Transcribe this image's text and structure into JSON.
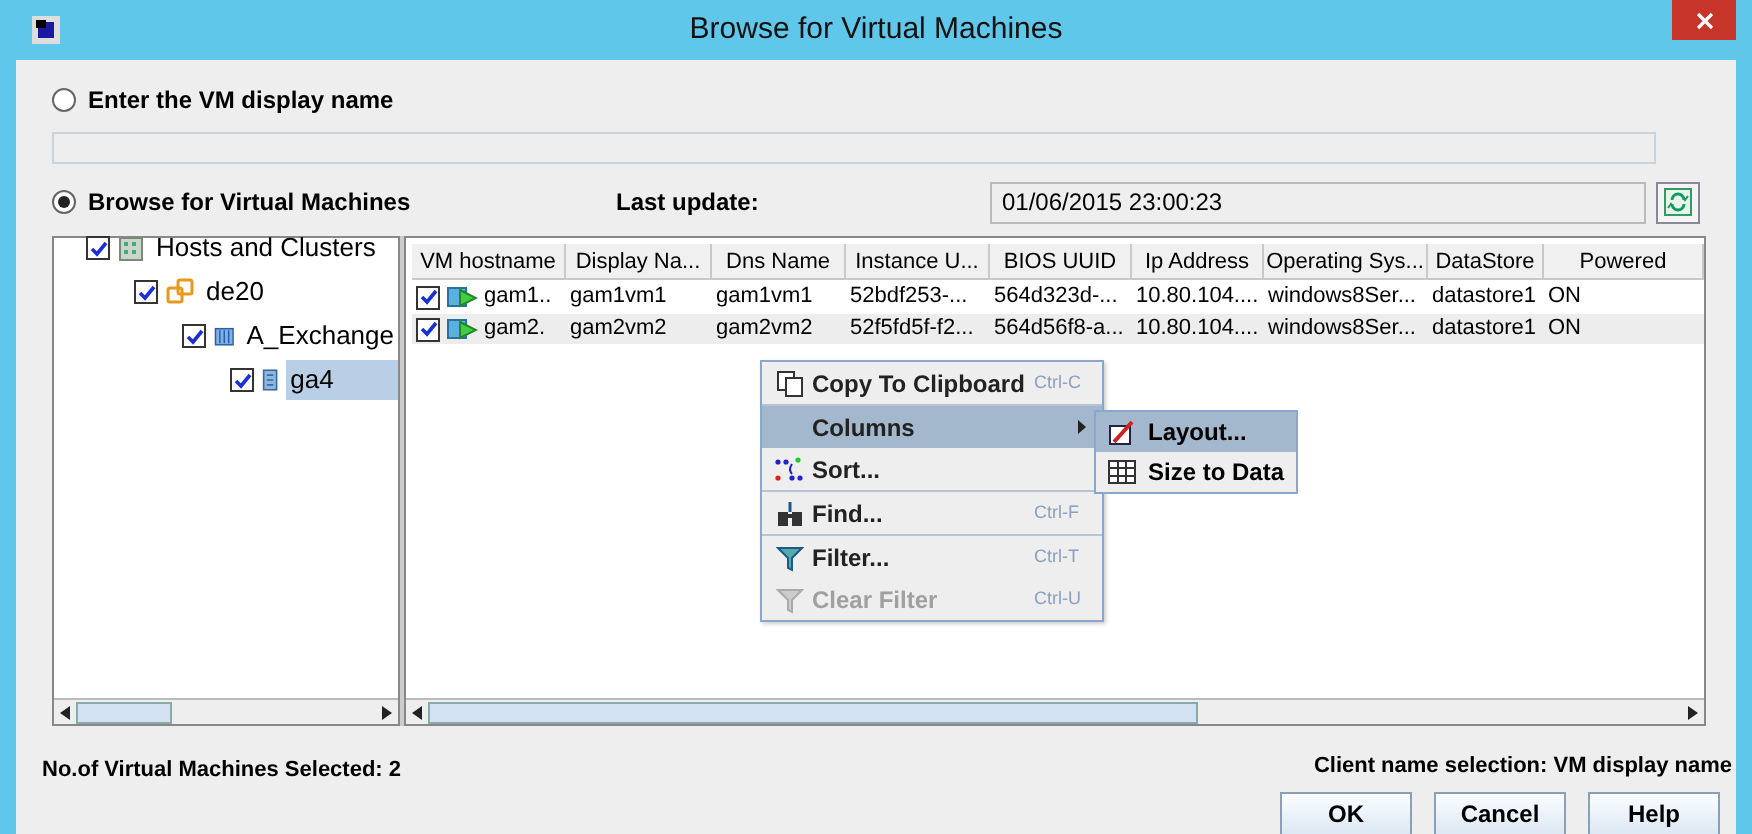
{
  "window": {
    "title": "Browse for Virtual Machines"
  },
  "modes": [
    {
      "label": "Enter the VM display name",
      "selected": false
    },
    {
      "label": "Browse for Virtual Machines",
      "selected": true
    }
  ],
  "last_update": {
    "label": "Last update:",
    "value": "01/06/2015 23:00:23"
  },
  "tree": [
    {
      "label": "Hosts and Clusters",
      "kind": "root",
      "checked": true,
      "selected": false,
      "children": [
        {
          "label": "de20",
          "kind": "datacenter",
          "checked": true,
          "selected": false,
          "children": [
            {
              "label": "A_Exchange",
              "kind": "cluster",
              "checked": true,
              "selected": false,
              "children": [
                {
                  "label": "ga4",
                  "kind": "host",
                  "checked": true,
                  "selected": true
                }
              ]
            }
          ]
        }
      ]
    }
  ],
  "table": {
    "columns": [
      "VM hostname",
      "Display Na...",
      "Dns Name",
      "Instance U...",
      "BIOS UUID",
      "Ip Address",
      "Operating Sys...",
      "DataStore",
      "Powered"
    ],
    "rows": [
      {
        "checked": true,
        "cells": [
          "gam1..",
          "gam1vm1",
          "gam1vm1",
          "52bdf253-...",
          "564d323d-...",
          "10.80.104....",
          "windows8Ser...",
          "datastore1",
          "ON"
        ]
      },
      {
        "checked": true,
        "cells": [
          "gam2.",
          "gam2vm2",
          "gam2vm2",
          "52f5fd5f-f2...",
          "564d56f8-a...",
          "10.80.104....",
          "windows8Ser...",
          "datastore1",
          "ON"
        ]
      }
    ]
  },
  "context_menu": [
    [
      {
        "label": "Copy To Clipboard",
        "kind": "copy",
        "shortcut": "Ctrl-C",
        "disabled": false,
        "selected": false
      }
    ],
    [
      {
        "label": "Columns",
        "kind": "submenu",
        "disabled": false,
        "selected": true
      },
      {
        "label": "Sort...",
        "kind": "sort",
        "disabled": false,
        "selected": false
      }
    ],
    [
      {
        "label": "Find...",
        "kind": "find",
        "shortcut": "Ctrl-F",
        "disabled": false,
        "selected": false
      }
    ],
    [
      {
        "label": "Filter...",
        "kind": "filter",
        "shortcut": "Ctrl-T",
        "disabled": false,
        "selected": false
      },
      {
        "label": "Clear Filter",
        "kind": "filter",
        "shortcut": "Ctrl-U",
        "disabled": true,
        "selected": false
      }
    ]
  ],
  "submenu": [
    {
      "label": "Layout...",
      "kind": "layout",
      "selected": true
    },
    {
      "label": "Size to Data",
      "kind": "grid",
      "selected": false
    }
  ],
  "status": "No.of Virtual Machines Selected: 2",
  "client_name_selection": "Client name selection: VM display name",
  "buttons": [
    "OK",
    "Cancel",
    "Help"
  ]
}
